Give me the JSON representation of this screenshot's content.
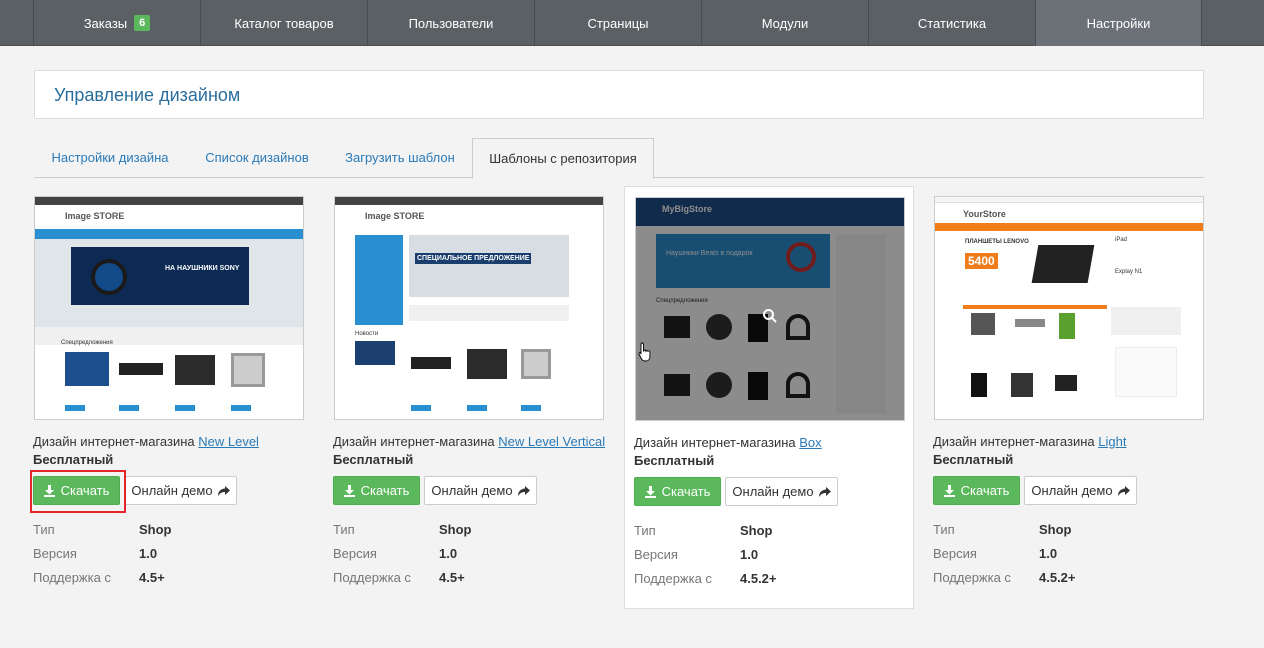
{
  "nav": {
    "items": [
      {
        "label": "Заказы",
        "badge": "6"
      },
      {
        "label": "Каталог товаров"
      },
      {
        "label": "Пользователи"
      },
      {
        "label": "Страницы"
      },
      {
        "label": "Модули"
      },
      {
        "label": "Статистика"
      },
      {
        "label": "Настройки"
      }
    ]
  },
  "page": {
    "title": "Управление дизайном"
  },
  "tabs": [
    {
      "label": "Настройки дизайна"
    },
    {
      "label": "Список дизайнов"
    },
    {
      "label": "Загрузить шаблон"
    },
    {
      "label": "Шаблоны с репозитория"
    }
  ],
  "labels": {
    "desc_prefix": "Дизайн интернет-магазина ",
    "price": "Бесплатный",
    "download": "Скачать",
    "demo": "Онлайн демо",
    "type": "Тип",
    "version": "Версия",
    "support": "Поддержка с"
  },
  "templates": [
    {
      "name": "New Level",
      "type": "Shop",
      "version": "1.0",
      "support": "4.5+",
      "thumb_logo": "Image STORE",
      "thumb_banner": "НА НАУШНИКИ SONY",
      "thumb_sub": "Спецпредложения"
    },
    {
      "name": "New Level Vertical",
      "type": "Shop",
      "version": "1.0",
      "support": "4.5+",
      "thumb_logo": "Image STORE",
      "thumb_banner": "СПЕЦИАЛЬНОЕ ПРЕДЛОЖЕНИЕ",
      "thumb_sub": "Новости"
    },
    {
      "name": "Box",
      "type": "Shop",
      "version": "1.0",
      "support": "4.5.2+",
      "thumb_logo": "MyBigStore",
      "thumb_banner": "Наушники Beats в подарок",
      "thumb_sub": "Спецпредложения"
    },
    {
      "name": "Light",
      "type": "Shop",
      "version": "1.0",
      "support": "4.5.2+",
      "thumb_logo": "YourStore",
      "thumb_banner": "ПЛАНШЕТЫ LENOVO",
      "thumb_sub": "5400",
      "thumb_extra": "iPad",
      "thumb_extra2": "Explay N1"
    }
  ],
  "colors": {
    "accent": "#2a7ab8",
    "success": "#5cb85c",
    "nav": "#5b6065",
    "highlight": "#e3262c"
  }
}
